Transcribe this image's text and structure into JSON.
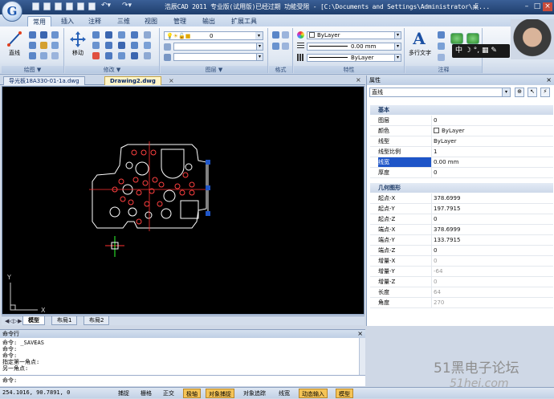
{
  "app": {
    "logo_letter": "G",
    "title": "浩辰CAD 2011 专业版(试用版)已经过期 功能受限 - [C:\\Documents and Settings\\Administrator\\桌..."
  },
  "ribbon_tabs": [
    "常用",
    "插入",
    "注释",
    "三维",
    "视图",
    "管理",
    "输出",
    "扩展工具"
  ],
  "ribbon": {
    "groups": {
      "draw": {
        "label": "绘图 ▼",
        "big_button": "直线"
      },
      "modify": {
        "label": "修改 ▼",
        "big_button": "移动"
      },
      "layers": {
        "label": "图层 ▼",
        "current_layer": "0"
      },
      "format": {
        "label": "格式"
      },
      "properties": {
        "label": "特性",
        "color": "ByLayer",
        "lineweight": "0.00 mm",
        "linetype": "ByLayer"
      },
      "annotation": {
        "label": "注释",
        "big_button": "多行文字"
      }
    }
  },
  "doc_tabs": [
    {
      "label": "导光板18A330-01-1a.dwg",
      "active": false
    },
    {
      "label": "Drawing2.dwg",
      "active": true
    }
  ],
  "canvas": {
    "ucs_x": "X",
    "ucs_y": "Y"
  },
  "layout_tabs": [
    {
      "label": "模型",
      "active": true
    },
    {
      "label": "布局1",
      "active": false
    },
    {
      "label": "布局2",
      "active": false
    }
  ],
  "properties_panel": {
    "title": "属性",
    "object_type": "直线",
    "sections": [
      {
        "name": "基本",
        "rows": [
          {
            "name": "图层",
            "value": "0"
          },
          {
            "name": "颜色",
            "value": "ByLayer"
          },
          {
            "name": "线型",
            "value": "ByLayer"
          },
          {
            "name": "线型比例",
            "value": "1"
          },
          {
            "name": "线宽",
            "value": "0.00 mm",
            "selected": true
          },
          {
            "name": "厚度",
            "value": "0"
          }
        ]
      },
      {
        "name": "几何图形",
        "rows": [
          {
            "name": "起点-X",
            "value": "378.6999"
          },
          {
            "name": "起点-Y",
            "value": "197.7915"
          },
          {
            "name": "起点-Z",
            "value": "0"
          },
          {
            "name": "端点-X",
            "value": "378.6999"
          },
          {
            "name": "端点-Y",
            "value": "133.7915"
          },
          {
            "name": "端点-Z",
            "value": "0"
          },
          {
            "name": "增量-X",
            "value": "0"
          },
          {
            "name": "增量-Y",
            "value": "-64"
          },
          {
            "name": "增量-Z",
            "value": "0"
          },
          {
            "name": "长度",
            "value": "64"
          },
          {
            "name": "角度",
            "value": "270"
          }
        ]
      }
    ]
  },
  "command_window": {
    "title": "命令行",
    "lines": [
      "命令: _SAVEAS",
      "命令:",
      "命令:",
      "指定第一角点:",
      "另一角点:"
    ],
    "prompt": "命令:"
  },
  "status_bar": {
    "coords": "254.1016, 90.7891, 0",
    "buttons": [
      {
        "label": "捕捉",
        "on": false
      },
      {
        "label": "栅格",
        "on": false
      },
      {
        "label": "正交",
        "on": false
      },
      {
        "label": "极轴",
        "on": true
      },
      {
        "label": "对象捕捉",
        "on": true
      },
      {
        "label": "对象追踪",
        "on": false
      },
      {
        "label": "线宽",
        "on": false
      },
      {
        "label": "动态输入",
        "on": true
      },
      {
        "label": "模型",
        "on": true
      }
    ]
  },
  "ime_bar": "中 ☽ °, ▦ ✎",
  "watermark": {
    "line1": "51黑电子论坛",
    "line2": "51hei.com"
  },
  "colors": {
    "canvas_bg": "#000000",
    "selection": "#1e55c8",
    "status_on": "#f5c456"
  }
}
